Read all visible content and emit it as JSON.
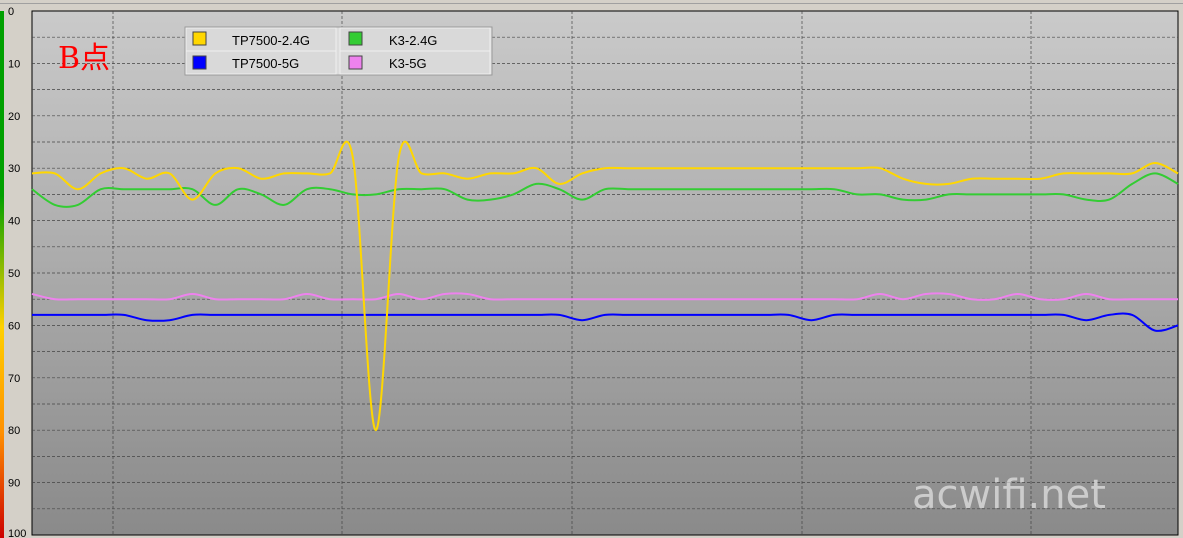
{
  "chart_data": {
    "type": "line",
    "title": "B点",
    "ylim": [
      0,
      100
    ],
    "y_ticks": [
      "0",
      "10",
      "20",
      "30",
      "40",
      "50",
      "60",
      "70",
      "80",
      "90",
      "100"
    ],
    "y_inverted": true,
    "grid": true,
    "legend_placement": "top-left",
    "x": [
      0,
      2,
      4,
      6,
      8,
      10,
      12,
      14,
      16,
      18,
      20,
      22,
      24,
      26,
      28,
      30,
      32,
      34,
      36,
      38,
      40,
      42,
      44,
      46,
      48,
      50,
      52,
      54,
      56,
      58,
      60,
      62,
      64,
      66,
      68,
      70,
      72,
      74,
      76,
      78,
      80,
      82,
      84,
      86,
      88,
      90,
      92,
      94,
      96,
      98,
      100
    ],
    "series": [
      {
        "name": "TP7500-2.4G",
        "color": "#ffd700",
        "values": [
          31,
          31,
          34,
          31,
          30,
          32,
          31,
          36,
          31,
          30,
          32,
          31,
          31,
          31,
          28,
          80,
          28,
          31,
          31,
          32,
          31,
          31,
          30,
          33,
          31,
          30,
          30,
          30,
          30,
          30,
          30,
          30,
          30,
          30,
          30,
          30,
          30,
          30,
          32,
          33,
          33,
          32,
          32,
          32,
          32,
          31,
          31,
          31,
          31,
          29,
          31
        ]
      },
      {
        "name": "K3-2.4G",
        "color": "#33cc33",
        "values": [
          34,
          37,
          37,
          34,
          34,
          34,
          34,
          34,
          37,
          34,
          35,
          37,
          34,
          34,
          35,
          35,
          34,
          34,
          34,
          36,
          36,
          35,
          33,
          34,
          36,
          34,
          34,
          34,
          34,
          34,
          34,
          34,
          34,
          34,
          34,
          34,
          35,
          35,
          36,
          36,
          35,
          35,
          35,
          35,
          35,
          35,
          36,
          36,
          33,
          31,
          33
        ]
      },
      {
        "name": "TP7500-5G",
        "color": "#0000ff",
        "values": [
          58,
          58,
          58,
          58,
          58,
          59,
          59,
          58,
          58,
          58,
          58,
          58,
          58,
          58,
          58,
          58,
          58,
          58,
          58,
          58,
          58,
          58,
          58,
          58,
          59,
          58,
          58,
          58,
          58,
          58,
          58,
          58,
          58,
          58,
          59,
          58,
          58,
          58,
          58,
          58,
          58,
          58,
          58,
          58,
          58,
          58,
          59,
          58,
          58,
          61,
          60
        ]
      },
      {
        "name": "K3-5G",
        "color": "#ee82ee",
        "values": [
          54,
          55,
          55,
          55,
          55,
          55,
          55,
          54,
          55,
          55,
          55,
          55,
          54,
          55,
          55,
          55,
          54,
          55,
          54,
          54,
          55,
          55,
          55,
          55,
          55,
          55,
          55,
          55,
          55,
          55,
          55,
          55,
          55,
          55,
          55,
          55,
          55,
          54,
          55,
          54,
          54,
          55,
          55,
          54,
          55,
          55,
          54,
          55,
          55,
          55,
          55
        ]
      }
    ]
  },
  "watermark": "acwifi.net",
  "colors": {
    "plot_top": "#cacaca",
    "plot_bottom": "#8a8a8a"
  }
}
